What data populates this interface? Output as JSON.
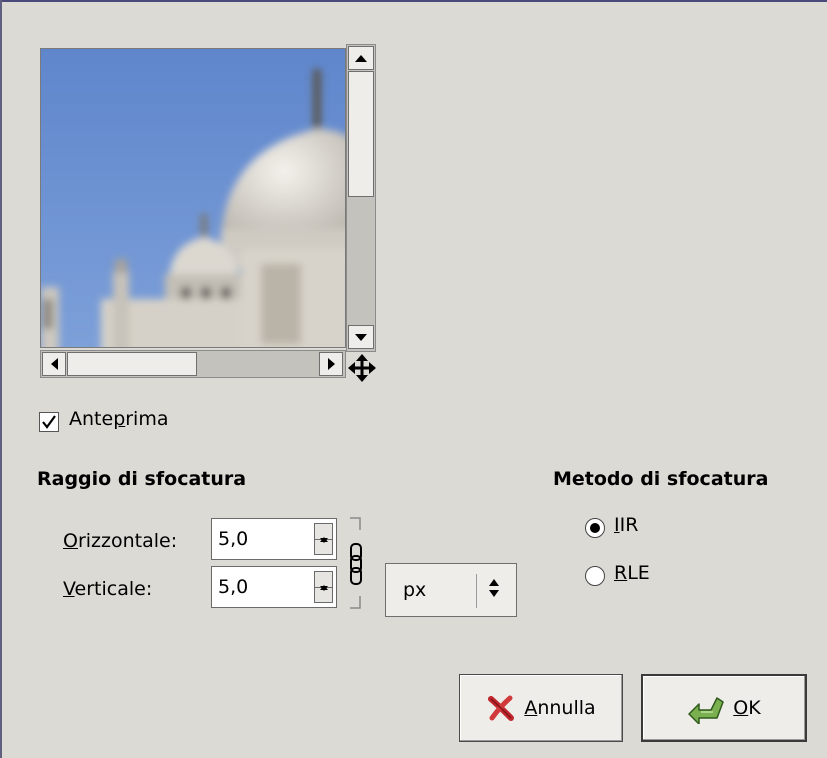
{
  "preview": {
    "image_name": "taj-mahal-blurred-preview",
    "nav_icon": "move-cross-arrows-icon"
  },
  "preview_toggle": {
    "checked": true,
    "label_before": "Ante",
    "label_mnemonic": "p",
    "label_after": "rima"
  },
  "radius_section": {
    "title": "Raggio di sfocatura",
    "horizontal": {
      "mnemonic": "O",
      "label_rest": "rizzontale:",
      "value": "5,0"
    },
    "vertical": {
      "mnemonic": "V",
      "label_rest": "erticale:",
      "value": "5,0"
    },
    "chain_icon": "chain-link-icon",
    "unit": "px"
  },
  "method_section": {
    "title": "Metodo di sfocatura",
    "options": [
      {
        "mnemonic": "I",
        "rest": "IR",
        "selected": true
      },
      {
        "mnemonic": "R",
        "rest": "LE",
        "selected": false
      }
    ]
  },
  "buttons": {
    "cancel": {
      "mnemonic": "A",
      "rest": "nnulla",
      "icon": "red-x-cancel-icon"
    },
    "ok": {
      "mnemonic": "O",
      "rest": "K",
      "icon": "green-arrow-ok-icon"
    }
  },
  "colors": {
    "window_bg": "#dcdad5",
    "sky": "#6f93d2",
    "radio_dot": "#000000"
  }
}
